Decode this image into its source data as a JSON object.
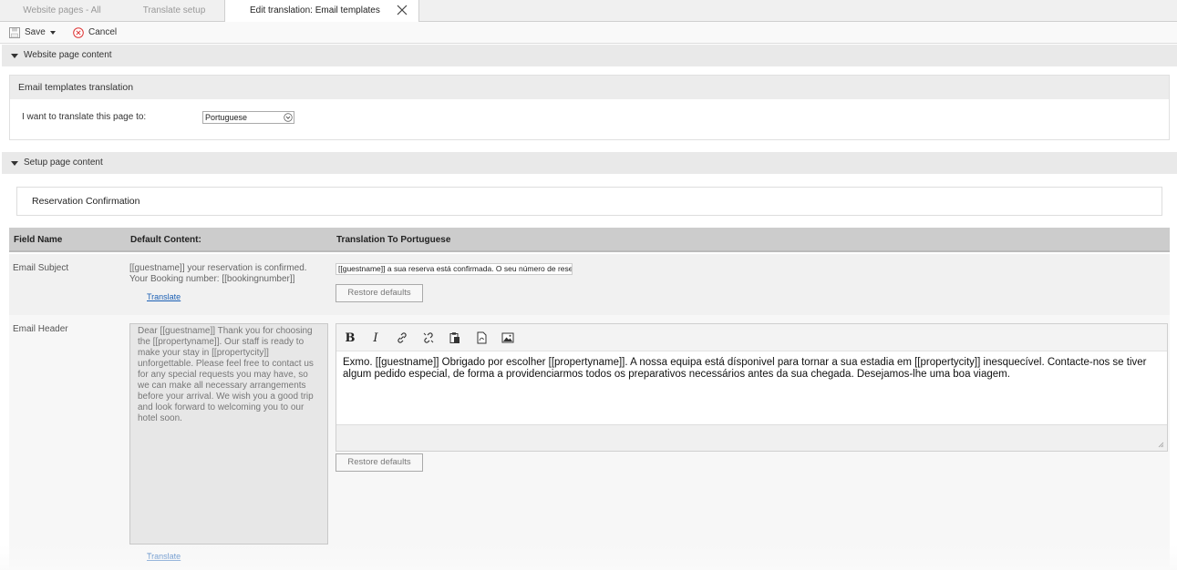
{
  "tabs": [
    {
      "label": "Website pages - All"
    },
    {
      "label": "Translate setup"
    },
    {
      "label": "Edit translation: Email templates"
    }
  ],
  "toolbar": {
    "save_label": "Save",
    "cancel_label": "Cancel"
  },
  "sections": {
    "website_content": "Website page content",
    "setup_content": "Setup page content"
  },
  "translation_box": {
    "title": "Email templates translation",
    "label": "I want to translate this page to:",
    "selected_language": "Portuguese"
  },
  "reservation_title": "Reservation Confirmation",
  "table": {
    "headers": [
      "Field Name",
      "Default Content:",
      "Translation To Portuguese"
    ],
    "rows": [
      {
        "field": "Email Subject",
        "default": "[[guestname]] your reservation is confirmed. Your Booking number: [[bookingnumber]]",
        "translate_link": "Translate",
        "translation": "[[guestname]] a sua reserva está confirmada. O seu número de rese",
        "restore_label": "Restore defaults"
      },
      {
        "field": "Email Header",
        "default": "Dear [[guestname]] Thank you for choosing the [[propertyname]]. Our staff is ready to make your stay in [[propertycity]] unforgettable. Please feel free to contact us for any special requests you may have, so we can make all necessary arrangements before your arrival. We wish you a good trip and look forward to welcoming you to our hotel soon.",
        "translate_link": "Translate",
        "translation": "Exmo. [[guestname]] Obrigado por escolher [[propertyname]]. A nossa equipa está dísponivel para tornar a sua estadia em [[propertycity]] inesquecível. Contacte-nos se tiver algum pedido especial, de forma a providenciarmos todos os preparativos necessários antes da sua chegada. Desejamos-lhe uma boa viagem.",
        "restore_label": "Restore defaults"
      }
    ]
  },
  "editor_toolbar": {
    "bold": "B",
    "italic": "I",
    "icons": [
      "link-icon",
      "unlink-icon",
      "paste-icon",
      "pdf-icon",
      "image-icon"
    ]
  }
}
